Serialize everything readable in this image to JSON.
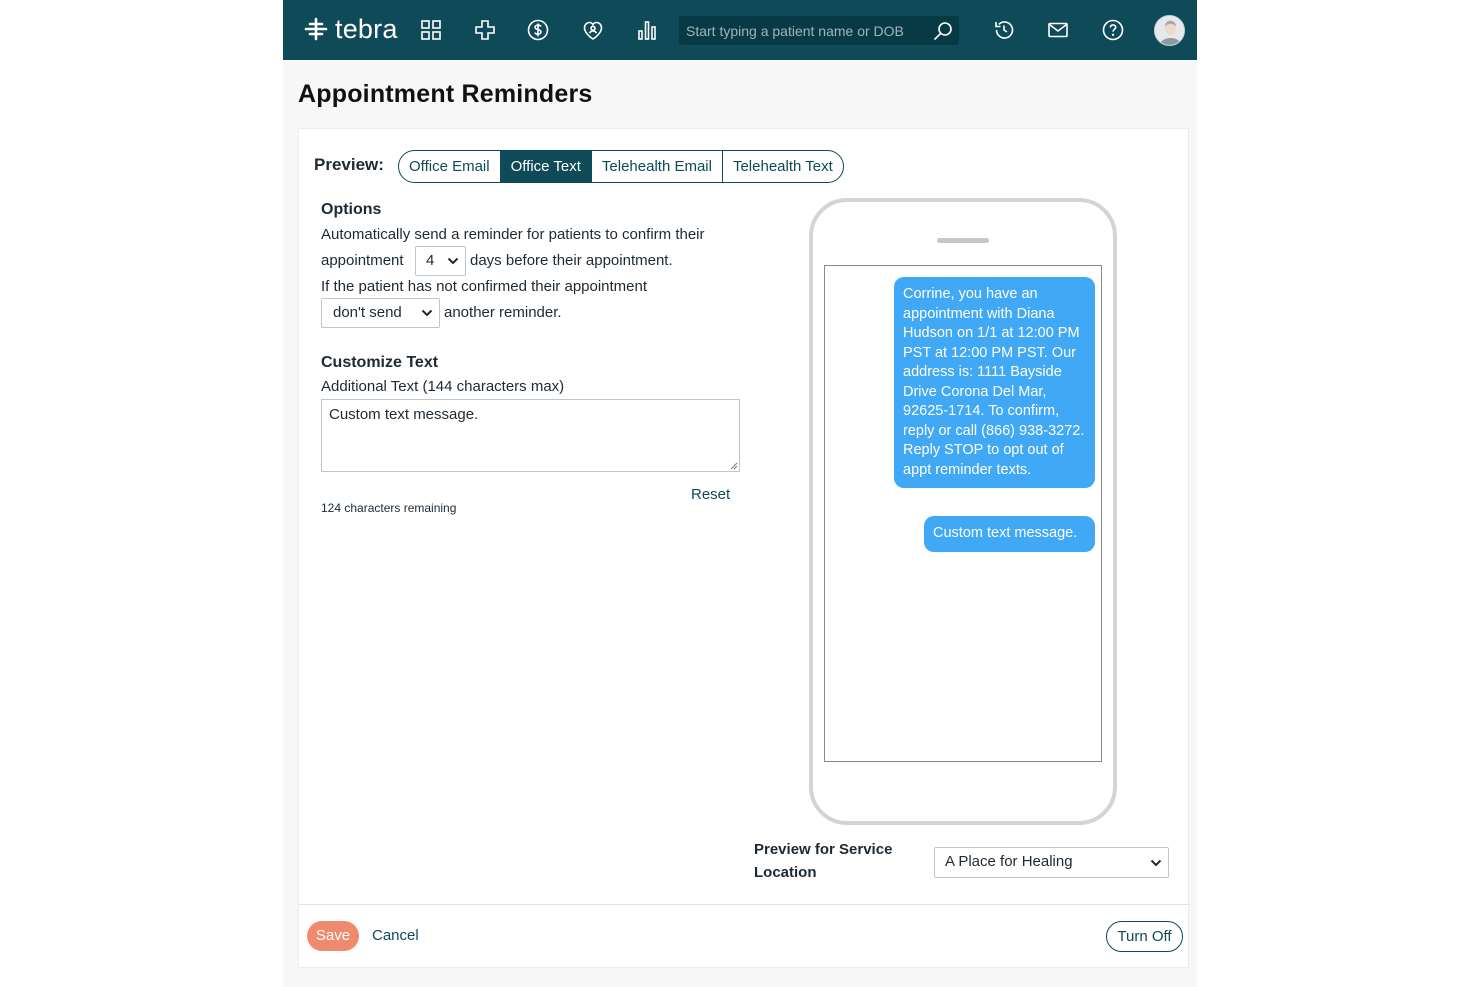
{
  "nav": {
    "brand": "tebra",
    "icons": [
      "dashboard-grid-icon",
      "medical-cross-icon",
      "billing-dollar-icon",
      "patient-heart-icon",
      "reports-chart-icon",
      "history-clock-icon",
      "mail-icon",
      "help-icon"
    ],
    "search_placeholder": "Start typing a patient name or DOB"
  },
  "page": {
    "title": "Appointment Reminders"
  },
  "preview": {
    "label": "Preview:",
    "tabs": [
      {
        "label": "Office Email",
        "active": false
      },
      {
        "label": "Office Text",
        "active": true
      },
      {
        "label": "Telehealth Email",
        "active": false
      },
      {
        "label": "Telehealth Text",
        "active": false
      }
    ]
  },
  "options": {
    "heading": "Options",
    "line1": "Automatically send a reminder for patients to confirm their",
    "line2_pre": "appointment",
    "days_value": "4",
    "line2_post": "days before their appointment.",
    "line3": "If the patient has not confirmed their appointment",
    "resend_value": "don't send",
    "line4_post": "another reminder."
  },
  "customize": {
    "heading": "Customize Text",
    "sublabel": "Additional Text (144 characters max)",
    "text_value": "Custom text message.",
    "remaining": "124 characters remaining",
    "reset": "Reset"
  },
  "phone_preview": {
    "message": "Corrine, you have an appointment with Diana Hudson on 1/1 at 12:00 PM PST at 12:00 PM PST. Our address is: 1111 Bayside Drive Corona Del Mar, 92625-1714. To confirm, reply or call (866) 938-3272. Reply STOP to opt out of appt reminder texts.",
    "custom": "Custom text message."
  },
  "location": {
    "label_line1": "Preview for Service",
    "label_line2": "Location",
    "value": "A Place for Healing"
  },
  "footer": {
    "save": "Save",
    "cancel": "Cancel",
    "turn_off": "Turn Off"
  },
  "colors": {
    "nav": "#0e4a57",
    "bubble": "#40a8f5",
    "save": "#f08a6e"
  }
}
